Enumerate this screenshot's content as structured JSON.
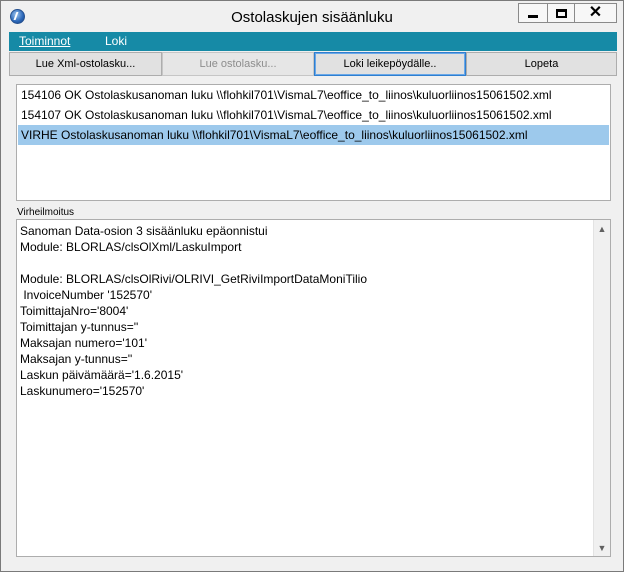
{
  "window": {
    "title": "Ostolaskujen sisäänluku"
  },
  "menu": [
    {
      "label": "Toiminnot"
    },
    {
      "label": "Loki"
    }
  ],
  "buttons": {
    "read_xml": "Lue Xml-ostolasku...",
    "read_invoice": "Lue ostolasku...",
    "copy_log": "Loki leikepöydälle..",
    "quit": "Lopeta"
  },
  "log": [
    "154106 OK Ostolaskusanoman luku \\\\flohkil701\\VismaL7\\eoffice_to_liinos\\kuluorliinos15061502.xml",
    "154107 OK Ostolaskusanoman luku \\\\flohkil701\\VismaL7\\eoffice_to_liinos\\kuluorliinos15061502.xml",
    "VIRHE Ostolaskusanoman luku \\\\flohkil701\\VismaL7\\eoffice_to_liinos\\kuluorliinos15061502.xml"
  ],
  "error": {
    "label": "Virheilmoitus",
    "text": "Sanoman Data-osion 3 sisäänluku epäonnistui\nModule: BLORLAS/clsOlXml/LaskuImport\n\nModule: BLORLAS/clsOlRivi/OLRIVI_GetRiviImportDataMoniTilio\n InvoiceNumber '152570'\nToimittajaNro='8004'\nToimittajan y-tunnus=''\nMaksajan numero='101'\nMaksajan y-tunnus=''\nLaskun päivämäärä='1.6.2015'\nLaskunumero='152570'"
  },
  "icons": {
    "app": "app-icon",
    "minimize": "minimize-icon",
    "maximize": "maximize-icon",
    "close": "close-icon",
    "scroll_up": "scroll-up-arrow-icon",
    "scroll_down": "scroll-down-arrow-icon"
  },
  "colors": {
    "menubar": "#168aa6",
    "selection": "#9dc9ec"
  }
}
